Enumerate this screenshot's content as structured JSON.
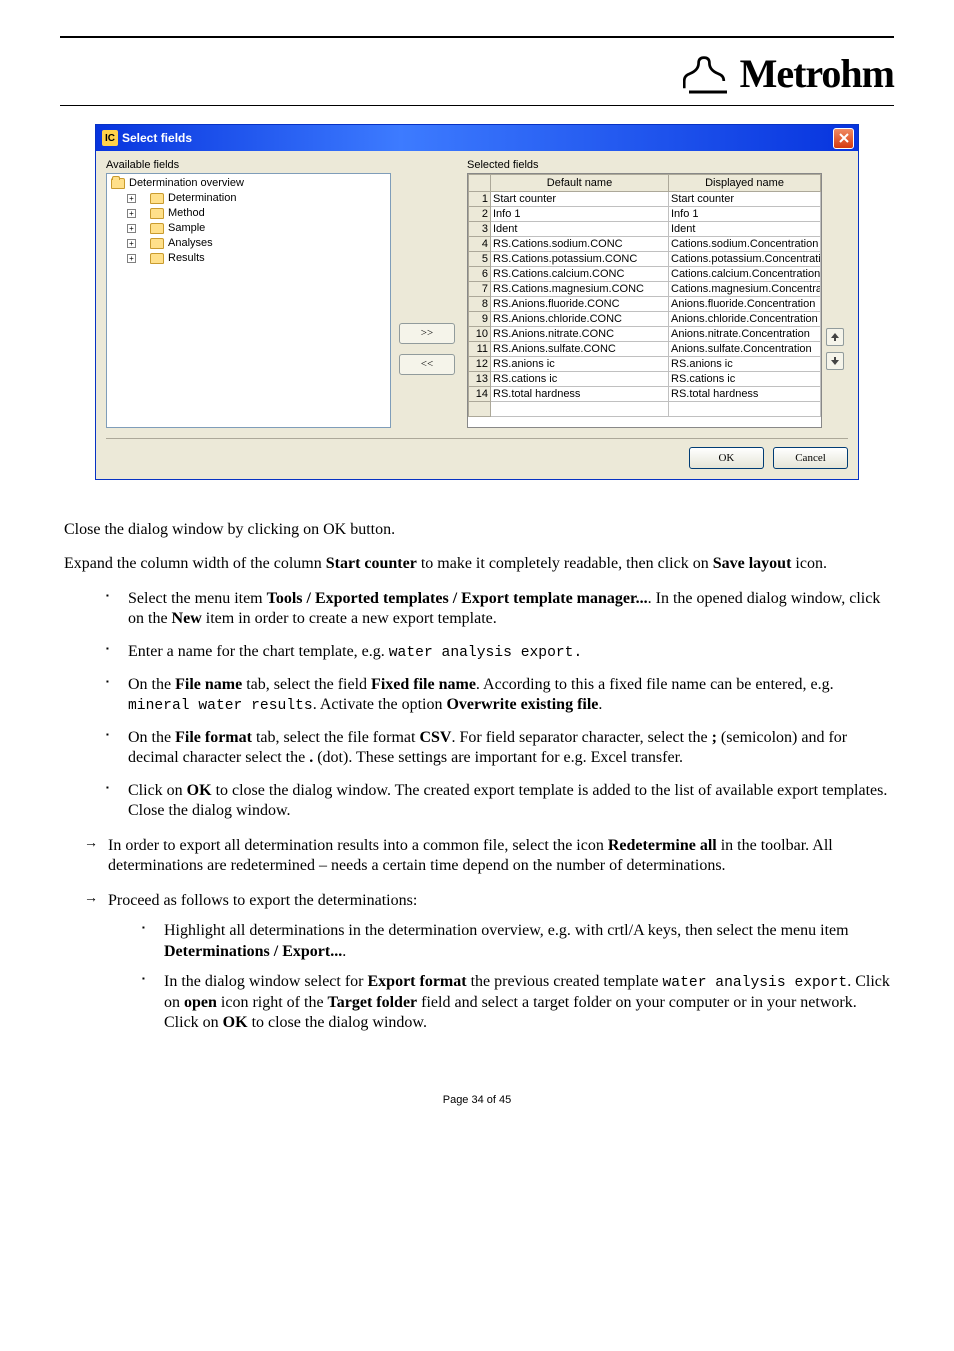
{
  "brand": "Metrohm",
  "dialog": {
    "title": "Select fields",
    "available_label": "Available fields",
    "selected_label": "Selected fields",
    "tree": {
      "root": "Determination overview",
      "children": [
        "Determination",
        "Method",
        "Sample",
        "Analyses",
        "Results"
      ]
    },
    "move_right": ">>",
    "move_left": "<<",
    "headers": {
      "num": "",
      "default": "Default name",
      "displayed": "Displayed name"
    },
    "rows": [
      {
        "n": "1",
        "def": "Start counter",
        "disp": "Start counter"
      },
      {
        "n": "2",
        "def": "Info 1",
        "disp": "Info 1"
      },
      {
        "n": "3",
        "def": "Ident",
        "disp": "Ident"
      },
      {
        "n": "4",
        "def": "RS.Cations.sodium.CONC",
        "disp": "Cations.sodium.Concentration"
      },
      {
        "n": "5",
        "def": "RS.Cations.potassium.CONC",
        "disp": "Cations.potassium.Concentration"
      },
      {
        "n": "6",
        "def": "RS.Cations.calcium.CONC",
        "disp": "Cations.calcium.Concentration"
      },
      {
        "n": "7",
        "def": "RS.Cations.magnesium.CONC",
        "disp": "Cations.magnesium.Concentration"
      },
      {
        "n": "8",
        "def": "RS.Anions.fluoride.CONC",
        "disp": "Anions.fluoride.Concentration"
      },
      {
        "n": "9",
        "def": "RS.Anions.chloride.CONC",
        "disp": "Anions.chloride.Concentration"
      },
      {
        "n": "10",
        "def": "RS.Anions.nitrate.CONC",
        "disp": "Anions.nitrate.Concentration"
      },
      {
        "n": "11",
        "def": "RS.Anions.sulfate.CONC",
        "disp": "Anions.sulfate.Concentration"
      },
      {
        "n": "12",
        "def": "RS.anions ic",
        "disp": "RS.anions ic"
      },
      {
        "n": "13",
        "def": "RS.cations ic",
        "disp": "RS.cations ic"
      },
      {
        "n": "14",
        "def": "RS.total hardness",
        "disp": "RS.total hardness"
      }
    ],
    "ok": "OK",
    "cancel": "Cancel"
  },
  "body": {
    "p1": "Close the dialog window by clicking on OK button.",
    "p2_a": "Expand the column width of the column ",
    "p2_b": "Start counter",
    "p2_c": " to make it completely readable, then click on ",
    "p2_d": "Save layout",
    "p2_e": " icon.",
    "b1_1a": "Select the menu item ",
    "b1_1b": "Tools / Exported templates / Export template manager...",
    "b1_1c": ". In the opened dialog window, click on the ",
    "b1_1d": "New",
    "b1_1e": " item in order to create a new export template.",
    "b1_2a": "Enter a name for the chart template, e.g. ",
    "b1_2b": "water analysis export.",
    "b1_3a": "On the ",
    "b1_3b": "File name",
    "b1_3c": " tab, select the field ",
    "b1_3d": "Fixed file name",
    "b1_3e": ". According to this a fixed file name can be entered, e.g. ",
    "b1_3f": "mineral water results",
    "b1_3g": ". Activate the option ",
    "b1_3h": "Overwrite existing file",
    "b1_3i": ".",
    "b1_4a": "On the ",
    "b1_4b": "File format",
    "b1_4c": " tab, select the file format ",
    "b1_4d": "CSV",
    "b1_4e": ". For field separator character, select the ",
    "b1_4f": ";",
    "b1_4g": " (semicolon) and for decimal character select the ",
    "b1_4h": ".",
    "b1_4i": " (dot). These settings are important for e.g. Excel transfer.",
    "b1_5a": "Click on ",
    "b1_5b": "OK",
    "b1_5c": " to close the dialog window. The created export template is added to the list of available export templates. Close the dialog window.",
    "a1_a": "In order to export all determination results into a common file, select the icon ",
    "a1_b": "Redetermine all",
    "a1_c": " in the toolbar. All determinations are redetermined – needs a certain time depend on the number of determinations.",
    "a2": "Proceed as follows to export the determinations:",
    "b2_1a": "Highlight all determinations in the determination overview, e.g. with crtl/A keys, then select the menu item ",
    "b2_1b": "Determinations / Export...",
    "b2_1c": ".",
    "b2_2a": "In the dialog window select for ",
    "b2_2b": "Export format",
    "b2_2c": " the previous created template ",
    "b2_2d": "water analysis export",
    "b2_2e": ". Click on ",
    "b2_2f": "open",
    "b2_2g": " icon right of the ",
    "b2_2h": "Target folder",
    "b2_2i": " field and select a target folder on your computer or in your network. Click on ",
    "b2_2j": "OK",
    "b2_2k": " to close the dialog window."
  },
  "footer": "Page 34 of 45"
}
